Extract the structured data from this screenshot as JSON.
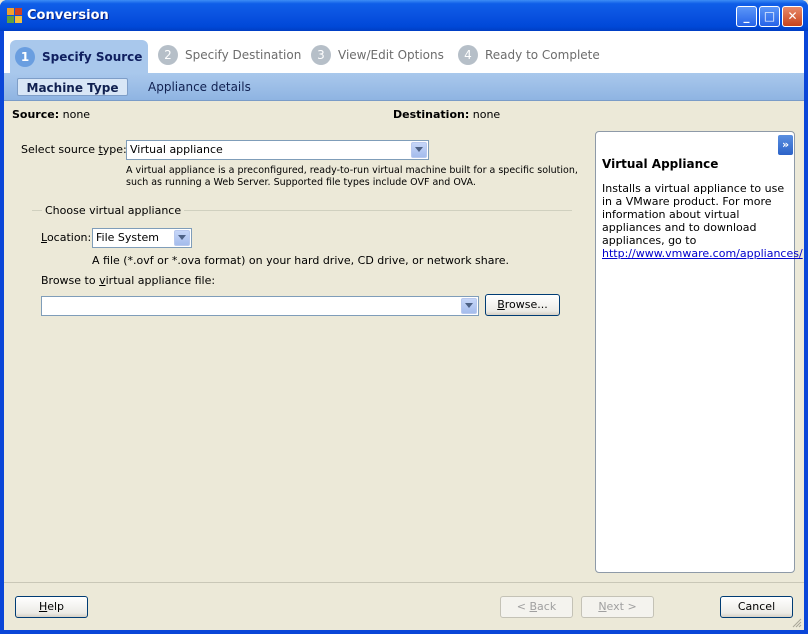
{
  "window": {
    "title": "Conversion"
  },
  "titlebar_buttons": {
    "minimize": "_",
    "maximize": "□",
    "close": "✕"
  },
  "steps": [
    {
      "num": "1",
      "label": "Specify Source"
    },
    {
      "num": "2",
      "label": "Specify Destination"
    },
    {
      "num": "3",
      "label": "View/Edit Options"
    },
    {
      "num": "4",
      "label": "Ready to Complete"
    }
  ],
  "subtabs": {
    "machine_type": "Machine Type",
    "appliance_details": "Appliance details"
  },
  "info": {
    "source_label": "Source:",
    "source_value": "none",
    "destination_label": "Destination:",
    "destination_value": "none"
  },
  "form": {
    "source_type_label_a": "Select source ",
    "source_type_label_u": "t",
    "source_type_label_b": "ype:",
    "source_type_value": "Virtual appliance",
    "source_desc_1": "A virtual appliance is a preconfigured, ready-to-run virtual machine built for a specific solution,",
    "source_desc_2": "such as running a Web Server. Supported file types include OVF and OVA.",
    "group_label": "Choose virtual appliance",
    "location_label_u": "L",
    "location_label_b": "ocation:",
    "location_value": "File System",
    "location_desc": "A file (*.ovf or *.ova format) on your hard drive, CD drive, or network share.",
    "browse_label_a": "Browse to ",
    "browse_label_u": "v",
    "browse_label_b": "irtual appliance file:",
    "file_value": "",
    "browse_button_u": "B",
    "browse_button_b": "rowse..."
  },
  "help": {
    "collapse": "»",
    "title": "Virtual Appliance",
    "body": "Installs a virtual appliance to use in a VMware product. For more information about virtual appliances and to download appliances, go to",
    "link": "http://www.vmware.com/appliances/"
  },
  "footer": {
    "help_u": "H",
    "help_b": "elp",
    "back_prefix": "< ",
    "back_u": "B",
    "back_b": "ack",
    "next_u": "N",
    "next_b": "ext >",
    "cancel": "Cancel"
  },
  "colors": {
    "titlebar": "#0a52e0",
    "step_active": "#a9c8ec",
    "link": "#0000cc"
  }
}
